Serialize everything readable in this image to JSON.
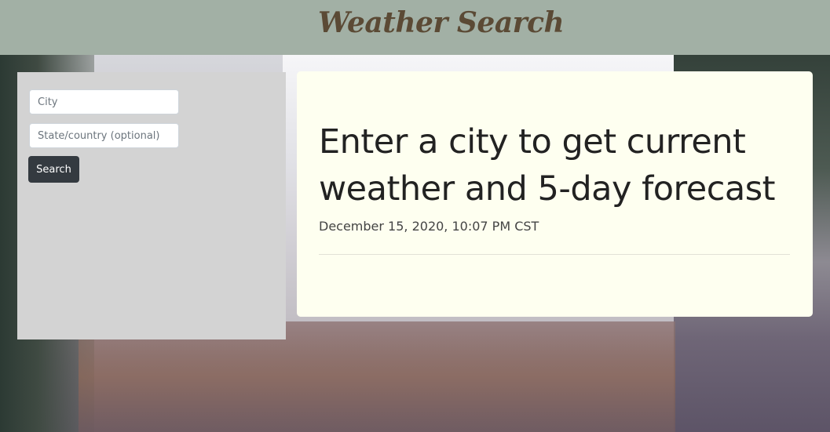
{
  "header": {
    "title": "Weather Search"
  },
  "search": {
    "city_placeholder": "City",
    "city_value": "",
    "state_placeholder": "State/country (optional)",
    "state_value": "",
    "button_label": "Search"
  },
  "result": {
    "heading": "Enter a city to get current weather and 5-day forecast",
    "date": "December 15, 2020, 10:07 PM CST"
  },
  "colors": {
    "header_bg": "#a2b0a5",
    "title_color": "#5b4a35",
    "panel_bg": "#d3d3d3",
    "card_bg": "#fefff0",
    "button_bg": "#343a40"
  }
}
